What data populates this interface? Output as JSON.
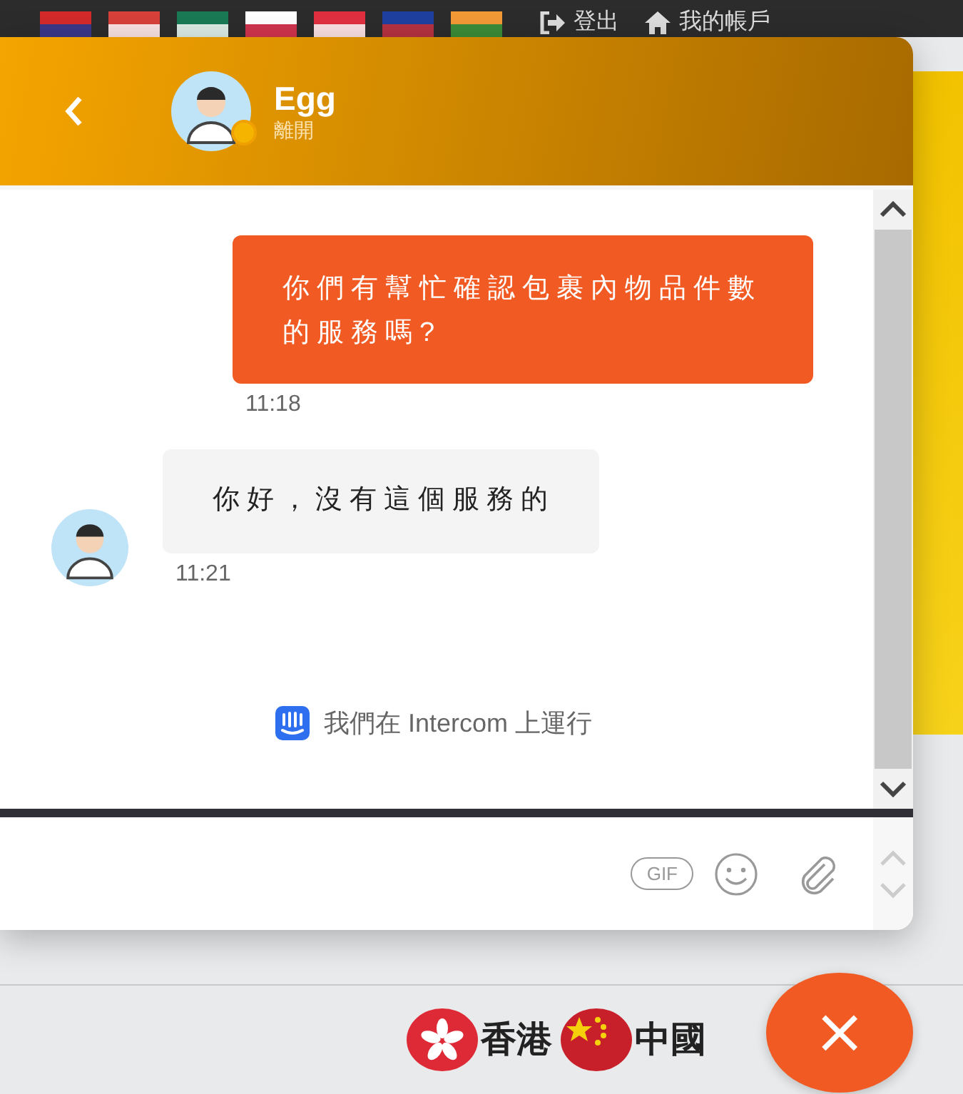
{
  "top_bar": {
    "links": [
      {
        "kind": "logout",
        "label": "登出"
      },
      {
        "kind": "account",
        "label": "我的帳戶"
      }
    ]
  },
  "chat": {
    "header": {
      "agent_name": "Egg",
      "status": "離開"
    },
    "messages": [
      {
        "kind": "sent",
        "text": "你們有幫忙確認包裹內物品件數的服務嗎?",
        "time": "11:18"
      },
      {
        "kind": "received",
        "text": "你好，沒有這個服務的",
        "time": "11:21"
      }
    ],
    "powered_by": "我們在 Intercom 上運行",
    "composer": {
      "gif_label": "GIF"
    }
  },
  "language_links": [
    {
      "kind": "hk",
      "label": "香港"
    },
    {
      "kind": "cn",
      "label": "中國"
    }
  ],
  "close_button": "×"
}
